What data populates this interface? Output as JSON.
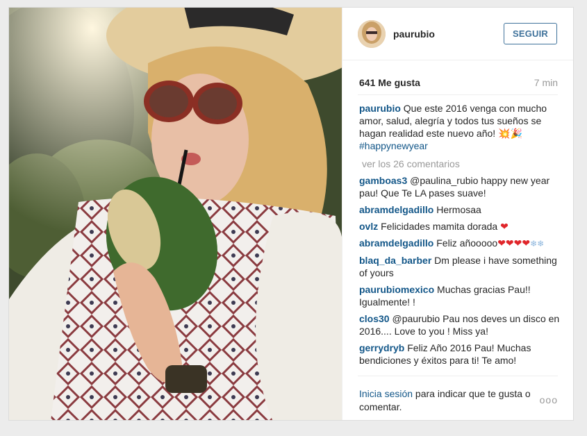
{
  "post": {
    "username": "paurubio",
    "follow_label": "SEGUIR",
    "likes": "641 Me gusta",
    "time": "7 min",
    "caption_user": "paurubio",
    "caption_text": " Que este 2016 venga con mucho amor, salud, alegría y todos tus sueños se hagan realidad este nuevo año! 💥🎉",
    "caption_hashtag": "#happynewyear",
    "view_all": "ver los 26 comentarios"
  },
  "comments": [
    {
      "user": "gamboas3",
      "text": " @paulina_rubio happy new year pau! Que Te LA pases suave!"
    },
    {
      "user": "abramdelgadillo",
      "text": " Hermosaa"
    },
    {
      "user": "ovlz",
      "text": " Felicidades mamita dorada ",
      "emoji": "❤"
    },
    {
      "user": "abramdelgadillo",
      "text": " Feliz añooooo",
      "emoji": "❤❤❤❤",
      "emoji2": "❄❄"
    },
    {
      "user": "blaq_da_barber",
      "text": " Dm please i have something of yours"
    },
    {
      "user": "paurubiomexico",
      "text": " Muchas gracias Pau!! Igualmente! !"
    },
    {
      "user": "clos30",
      "text": " @paurubio Pau nos deves un disco en 2016.... Love to you ! Miss ya!"
    },
    {
      "user": "gerrydryb",
      "text": " Feliz Año 2016 Pau! Muchas bendiciones y éxitos para ti! Te amo!"
    }
  ],
  "footer": {
    "login_link": "Inicia sesión",
    "login_rest": " para indicar que te gusta o comentar.",
    "more": "ooo"
  },
  "icons": {
    "more": "more-options-icon"
  },
  "colors": {
    "link": "#125688",
    "button": "#3f729b",
    "muted": "#999999",
    "heart": "#e0252a"
  }
}
